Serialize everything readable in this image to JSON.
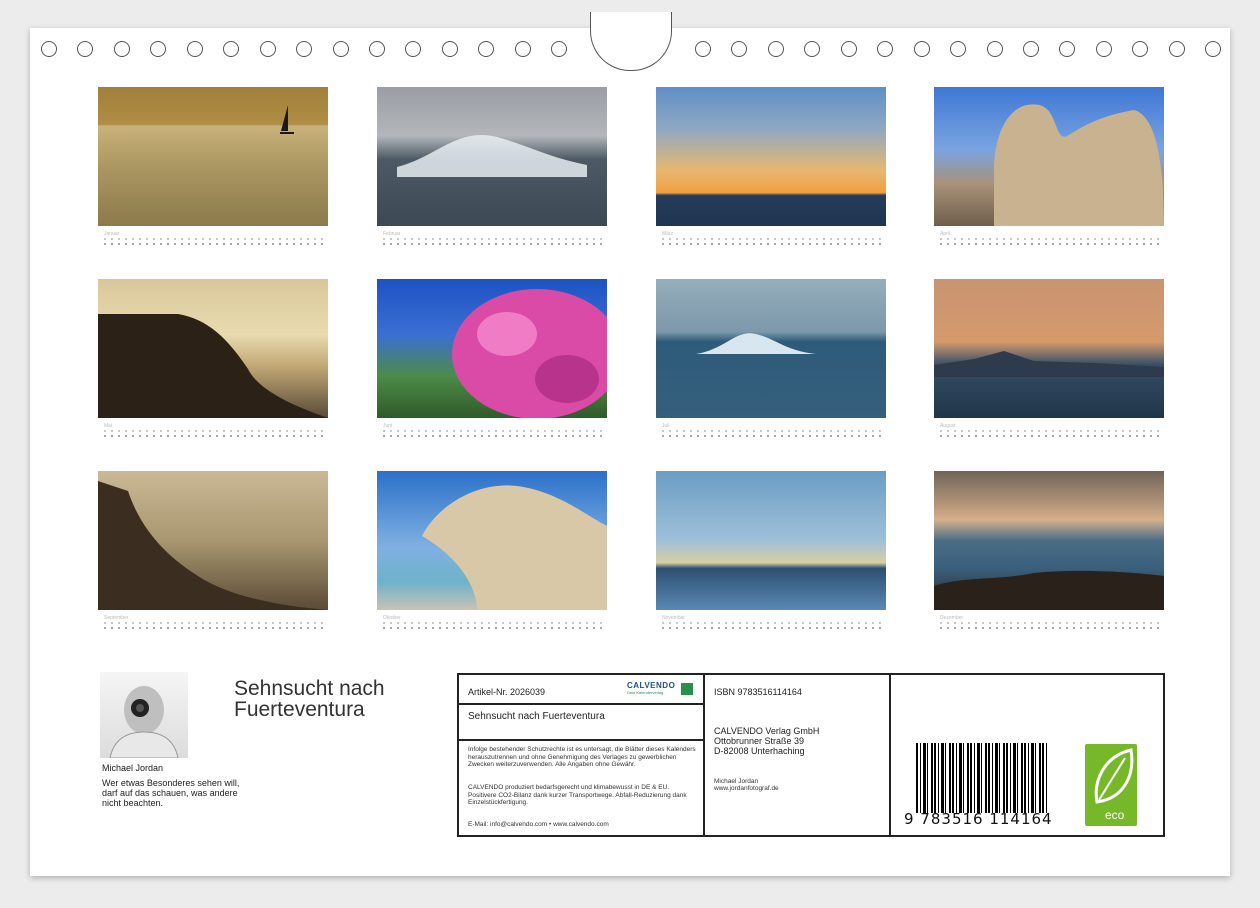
{
  "months": [
    {
      "key": "jan",
      "label": "Januar"
    },
    {
      "key": "feb",
      "label": "Februar"
    },
    {
      "key": "mar",
      "label": "März"
    },
    {
      "key": "apr",
      "label": "April"
    },
    {
      "key": "may",
      "label": "Mai"
    },
    {
      "key": "jun",
      "label": "Juni"
    },
    {
      "key": "jul",
      "label": "Juli"
    },
    {
      "key": "aug",
      "label": "August"
    },
    {
      "key": "sep",
      "label": "September"
    },
    {
      "key": "oct",
      "label": "Oktober"
    },
    {
      "key": "nov",
      "label": "November"
    },
    {
      "key": "dec",
      "label": "Dezember"
    }
  ],
  "author": {
    "name": "Michael Jordan",
    "quote": "Wer etwas Besonderes sehen will, darf auf das schauen, was andere nicht beachten."
  },
  "calendar_title": "Sehnsucht nach Fuerteventura",
  "info": {
    "article": "Artikel-Nr. 2026039",
    "brand": "CALVENDO",
    "brand_tagline": "Dein Kalenderverlag",
    "title": "Sehnsucht nach Fuerteventura",
    "legal": "Infolge bestehender Schutzrechte ist es untersagt, die Blätter dieses Kalenders herauszutrennen und ohne Genehmigung des Verlages zu gewerblichen Zwecken weiterzuverwenden. Alle Angaben ohne Gewähr.",
    "climate": "CALVENDO produziert bedarfsgerecht und klimabewusst in DE & EU. Positivere CO2-Bilanz dank kurzer Transportwege. Abfall-Reduzierung dank Einzelstückfertigung.",
    "contact": "E-Mail: info@calvendo.com • www.calvendo.com",
    "isbn": "ISBN 9783516114164",
    "publisher_name": "CALVENDO Verlag GmbH",
    "publisher_street": "Ottobrunner Straße 39",
    "publisher_city": "D-82008 Unterhaching",
    "photographer": "Michael Jordan",
    "photographer_site": "www.jordanfotograf.de",
    "barcode_digits": "9 783516 114164",
    "eco_label": "eco"
  }
}
